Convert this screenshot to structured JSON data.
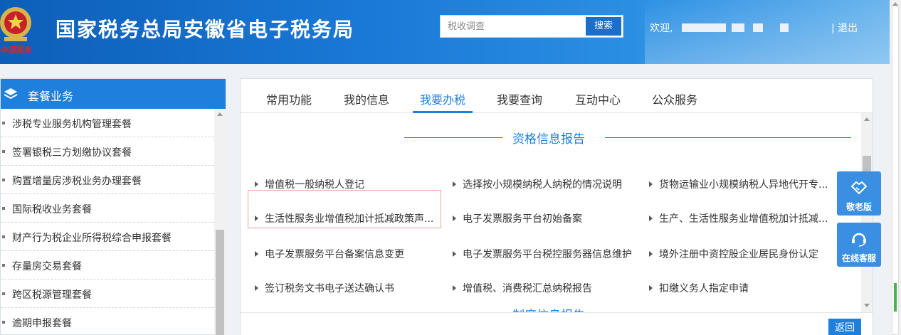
{
  "header": {
    "site_title": "国家税务总局安徽省电子税务局",
    "emblem_text": "中国税务",
    "search": {
      "placeholder": "税收调查",
      "button_label": "搜索"
    },
    "welcome_label": "欢迎,",
    "logout_label": "| 退出"
  },
  "sidebar": {
    "title": "套餐业务",
    "items": [
      {
        "label": "涉税专业服务机构管理套餐"
      },
      {
        "label": "签署银税三方划缴协议套餐"
      },
      {
        "label": "购置增量房涉税业务办理套餐"
      },
      {
        "label": "国际税收业务套餐"
      },
      {
        "label": "财产行为税企业所得税综合申报套餐"
      },
      {
        "label": "存量房交易套餐"
      },
      {
        "label": "跨区税源管理套餐"
      },
      {
        "label": "逾期申报套餐"
      }
    ]
  },
  "main": {
    "tabs": [
      {
        "label": "常用功能",
        "active": false
      },
      {
        "label": "我的信息",
        "active": false
      },
      {
        "label": "我要办税",
        "active": true
      },
      {
        "label": "我要查询",
        "active": false
      },
      {
        "label": "互动中心",
        "active": false
      },
      {
        "label": "公众服务",
        "active": false
      }
    ],
    "section_title": "资格信息报告",
    "services": [
      {
        "label": "增值税一般纳税人登记"
      },
      {
        "label": "选择按小规模纳税人纳税的情况说明"
      },
      {
        "label": "货物运输业小规模纳税人异地代开专..."
      },
      {
        "label": "生活性服务业增值税加计抵减政策声..."
      },
      {
        "label": "电子发票服务平台初始备案"
      },
      {
        "label": "生产、生活性服务业增值税加计抵减..."
      },
      {
        "label": "电子发票服务平台备案信息变更"
      },
      {
        "label": "电子发票服务平台税控服务器信息维护"
      },
      {
        "label": "境外注册中资控股企业居民身份认定"
      },
      {
        "label": "签订税务文书电子送达确认书"
      },
      {
        "label": "增值税、消费税汇总纳税报告"
      },
      {
        "label": "扣缴义务人指定申请"
      }
    ],
    "next_section_title": "制度信息报告",
    "back_label": "返回"
  },
  "floating": {
    "elder_label": "敬老版",
    "service_label": "在线客服"
  },
  "colors": {
    "brand": "#1e7fdc",
    "header_dark": "#0c5fb8",
    "highlight": "#f0a39a"
  }
}
